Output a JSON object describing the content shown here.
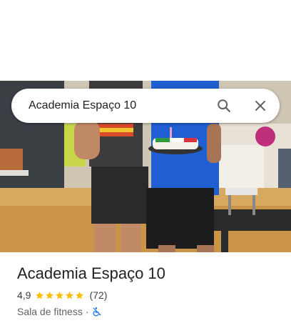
{
  "search": {
    "query": "Academia Espaço 10"
  },
  "icons": {
    "search": "search-icon",
    "close": "close-icon",
    "accessibility": "no-wheelchair-access-icon"
  },
  "place": {
    "name": "Academia Espaço 10",
    "rating_text": "4,9",
    "rating_value": 4.9,
    "stars_max": 5,
    "review_count": "(72)",
    "category": "Sala de fitness",
    "separator": "·"
  },
  "colors": {
    "star": "#fbbc04",
    "accessibility_icon": "#1a73e8",
    "text": "#202124"
  }
}
